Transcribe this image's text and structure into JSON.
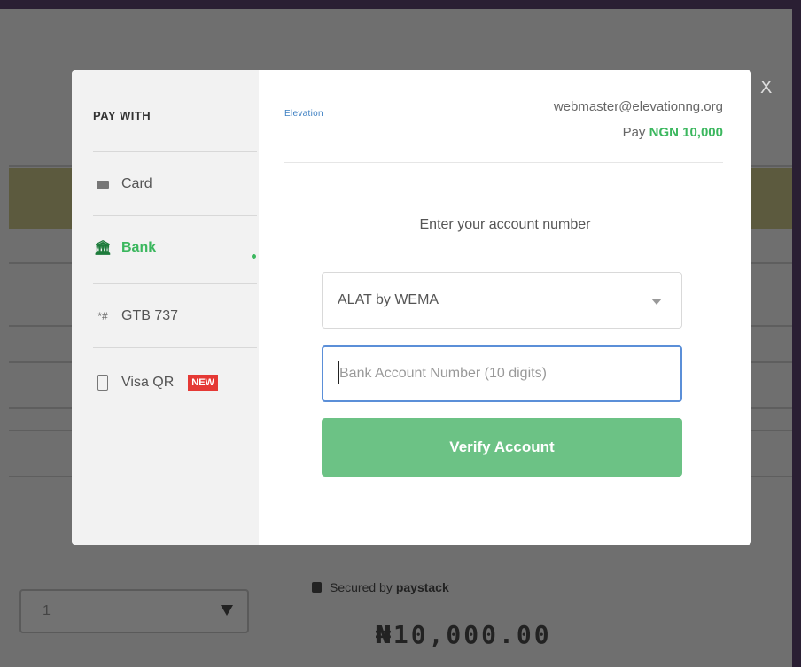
{
  "background": {
    "quantity_select": "1",
    "secured_label": "Secured by",
    "secured_brand": "paystack",
    "total": "₦10,000.00"
  },
  "modal": {
    "close_label": "X",
    "sidebar": {
      "heading": "PAY WITH",
      "items": [
        {
          "label": "Card",
          "icon": "card-icon",
          "active": false
        },
        {
          "label": "Bank",
          "icon": "bank-icon",
          "active": true
        },
        {
          "label": "GTB 737",
          "icon": "ussd-icon",
          "active": false
        },
        {
          "label": "Visa QR",
          "icon": "qr-icon",
          "active": false,
          "badge": "NEW"
        }
      ]
    },
    "main": {
      "logo_text": "Elevation",
      "merchant_email": "webmaster@elevationng.org",
      "pay_label": "Pay",
      "pay_amount": "NGN 10,000",
      "prompt": "Enter your account number",
      "bank_select": "ALAT by WEMA",
      "account_placeholder": "Bank Account Number (10 digits)",
      "verify_label": "Verify Account"
    }
  },
  "colors": {
    "accent_green": "#3bb75e",
    "button_green": "#6cc285",
    "badge_red": "#e53935",
    "focus_blue": "#5b8fd8"
  }
}
